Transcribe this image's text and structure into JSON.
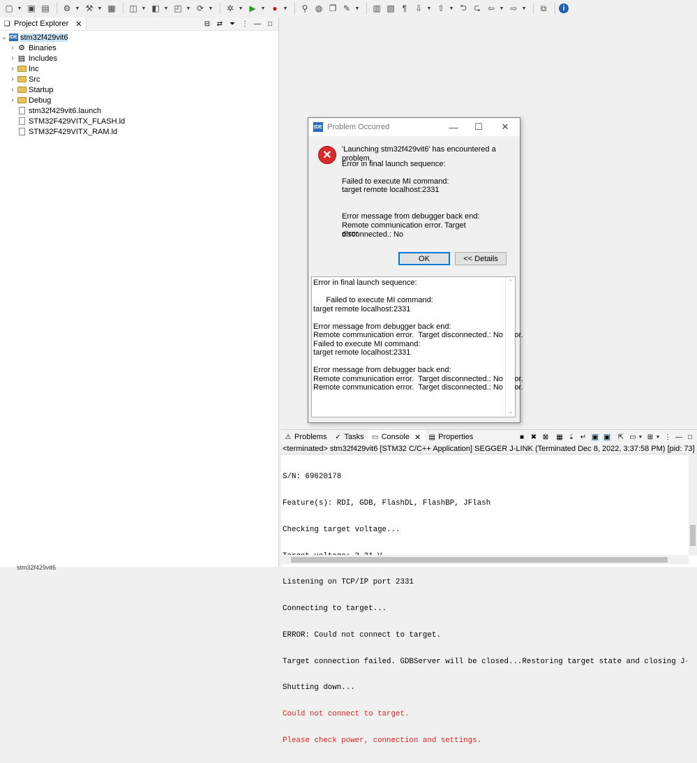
{
  "project_explorer": {
    "title": "Project Explorer",
    "project": "stm32f429vit6",
    "items": [
      {
        "label": "Binaries",
        "icon": "binaries-icon",
        "expandable": true
      },
      {
        "label": "Includes",
        "icon": "includes-icon",
        "expandable": true
      },
      {
        "label": "Inc",
        "icon": "folder-icon",
        "expandable": true
      },
      {
        "label": "Src",
        "icon": "folder-icon",
        "expandable": true
      },
      {
        "label": "Startup",
        "icon": "folder-icon",
        "expandable": true
      },
      {
        "label": "Debug",
        "icon": "folder-icon",
        "expandable": true
      },
      {
        "label": "stm32f429vit6.launch",
        "icon": "file-icon",
        "expandable": false
      },
      {
        "label": "STM32F429VITX_FLASH.ld",
        "icon": "file-icon",
        "expandable": false
      },
      {
        "label": "STM32F429VITX_RAM.ld",
        "icon": "file-icon",
        "expandable": false
      }
    ]
  },
  "dialog": {
    "badge": "IDE",
    "title": "Problem Occurred",
    "headline": "'Launching stm32f429vit6' has encountered a problem.",
    "line1": "Error in final launch sequence:",
    "line2": "Failed to execute MI command:",
    "line3": "target remote localhost:2331",
    "line4": "Error message from debugger back end:",
    "line5": "Remote communication error.  Target disconnected.: No",
    "line6": "error.",
    "ok_label": "OK",
    "details_label": "<< Details",
    "details_text": "Error in final launch sequence:\n\n      Failed to execute MI command:\ntarget remote localhost:2331\n\nError message from debugger back end:\nRemote communication error.  Target disconnected.: No error.\nFailed to execute MI command:\ntarget remote localhost:2331\n\nError message from debugger back end:\nRemote communication error.  Target disconnected.: No error.\nRemote communication error.  Target disconnected.: No error."
  },
  "console": {
    "tabs": [
      {
        "label": "Problems",
        "icon": "problems-icon"
      },
      {
        "label": "Tasks",
        "icon": "tasks-icon"
      },
      {
        "label": "Console",
        "icon": "console-icon"
      },
      {
        "label": "Properties",
        "icon": "properties-icon"
      }
    ],
    "terminated": "<terminated> stm32f429vit6 [STM32 C/C++ Application] SEGGER J-LINK (Terminated Dec 8, 2022, 3:37:58 PM) [pid: 73]",
    "lines": [
      "S/N: 69620178",
      "Feature(s): RDI, GDB, FlashDL, FlashBP, JFlash",
      "Checking target voltage...",
      "Target voltage: 3.31 V",
      "Listening on TCP/IP port 2331",
      "Connecting to target...",
      "ERROR: Could not connect to target.",
      "Target connection failed. GDBServer will be closed...Restoring target state and closing J-Link conne",
      "Shutting down..."
    ],
    "error_lines": [
      "Could not connect to target.",
      "Please check power, connection and settings."
    ],
    "error_color": "#e02020"
  },
  "status_bar": {
    "text": "stm32f429vit6"
  }
}
